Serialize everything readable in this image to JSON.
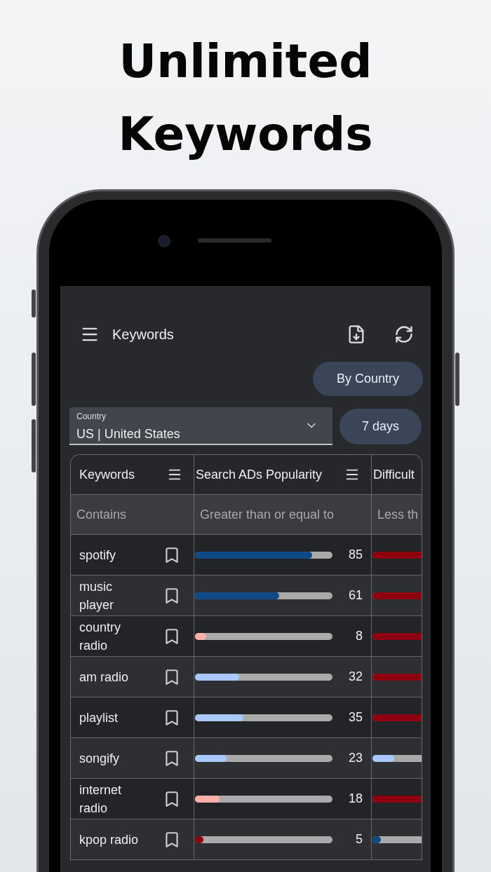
{
  "headline": "Unlimited Keywords",
  "app_bar": {
    "title": "Keywords"
  },
  "by_country_button": "By Country",
  "country_field": {
    "label": "Country",
    "value": "US | United States"
  },
  "period_button": "7 days",
  "table": {
    "columns": [
      {
        "title": "Keywords",
        "filter_placeholder": "Contains"
      },
      {
        "title": "Search ADs Popularity",
        "filter_placeholder": "Greater than or equal to"
      },
      {
        "title": "Difficult",
        "filter_placeholder": "Less th"
      }
    ],
    "rows": [
      {
        "keyword": "spotify",
        "popularity": {
          "level": 0.85,
          "color": "#0d4a86",
          "reading": "85"
        },
        "difficulty": {
          "level": 0.9,
          "color": "#8e0010"
        }
      },
      {
        "keyword": "music player",
        "popularity": {
          "level": 0.61,
          "color": "#0d4a86",
          "reading": "61"
        },
        "difficulty": {
          "level": 0.9,
          "color": "#8e0010"
        }
      },
      {
        "keyword": "country radio",
        "popularity": {
          "level": 0.08,
          "color": "#ffb0a8",
          "reading": "8"
        },
        "difficulty": {
          "level": 0.9,
          "color": "#8e0010"
        }
      },
      {
        "keyword": "am radio",
        "popularity": {
          "level": 0.32,
          "color": "#a8c8ff",
          "reading": "32"
        },
        "difficulty": {
          "level": 0.9,
          "color": "#8e0010"
        }
      },
      {
        "keyword": "playlist",
        "popularity": {
          "level": 0.35,
          "color": "#a8c8ff",
          "reading": "35"
        },
        "difficulty": {
          "level": 0.9,
          "color": "#8e0010"
        }
      },
      {
        "keyword": "songify",
        "popularity": {
          "level": 0.23,
          "color": "#a8c8ff",
          "reading": "23"
        },
        "difficulty": {
          "level": 0.16,
          "color": "#a8c8ff"
        }
      },
      {
        "keyword": "internet radio",
        "popularity": {
          "level": 0.18,
          "color": "#ffb0a8",
          "reading": "18"
        },
        "difficulty": {
          "level": 0.9,
          "color": "#8e0010"
        }
      },
      {
        "keyword": "kpop radio",
        "popularity": {
          "level": 0.05,
          "color": "#8e0010",
          "reading": "5"
        },
        "difficulty": {
          "level": 0.05,
          "color": "#0d4a86"
        }
      }
    ]
  }
}
